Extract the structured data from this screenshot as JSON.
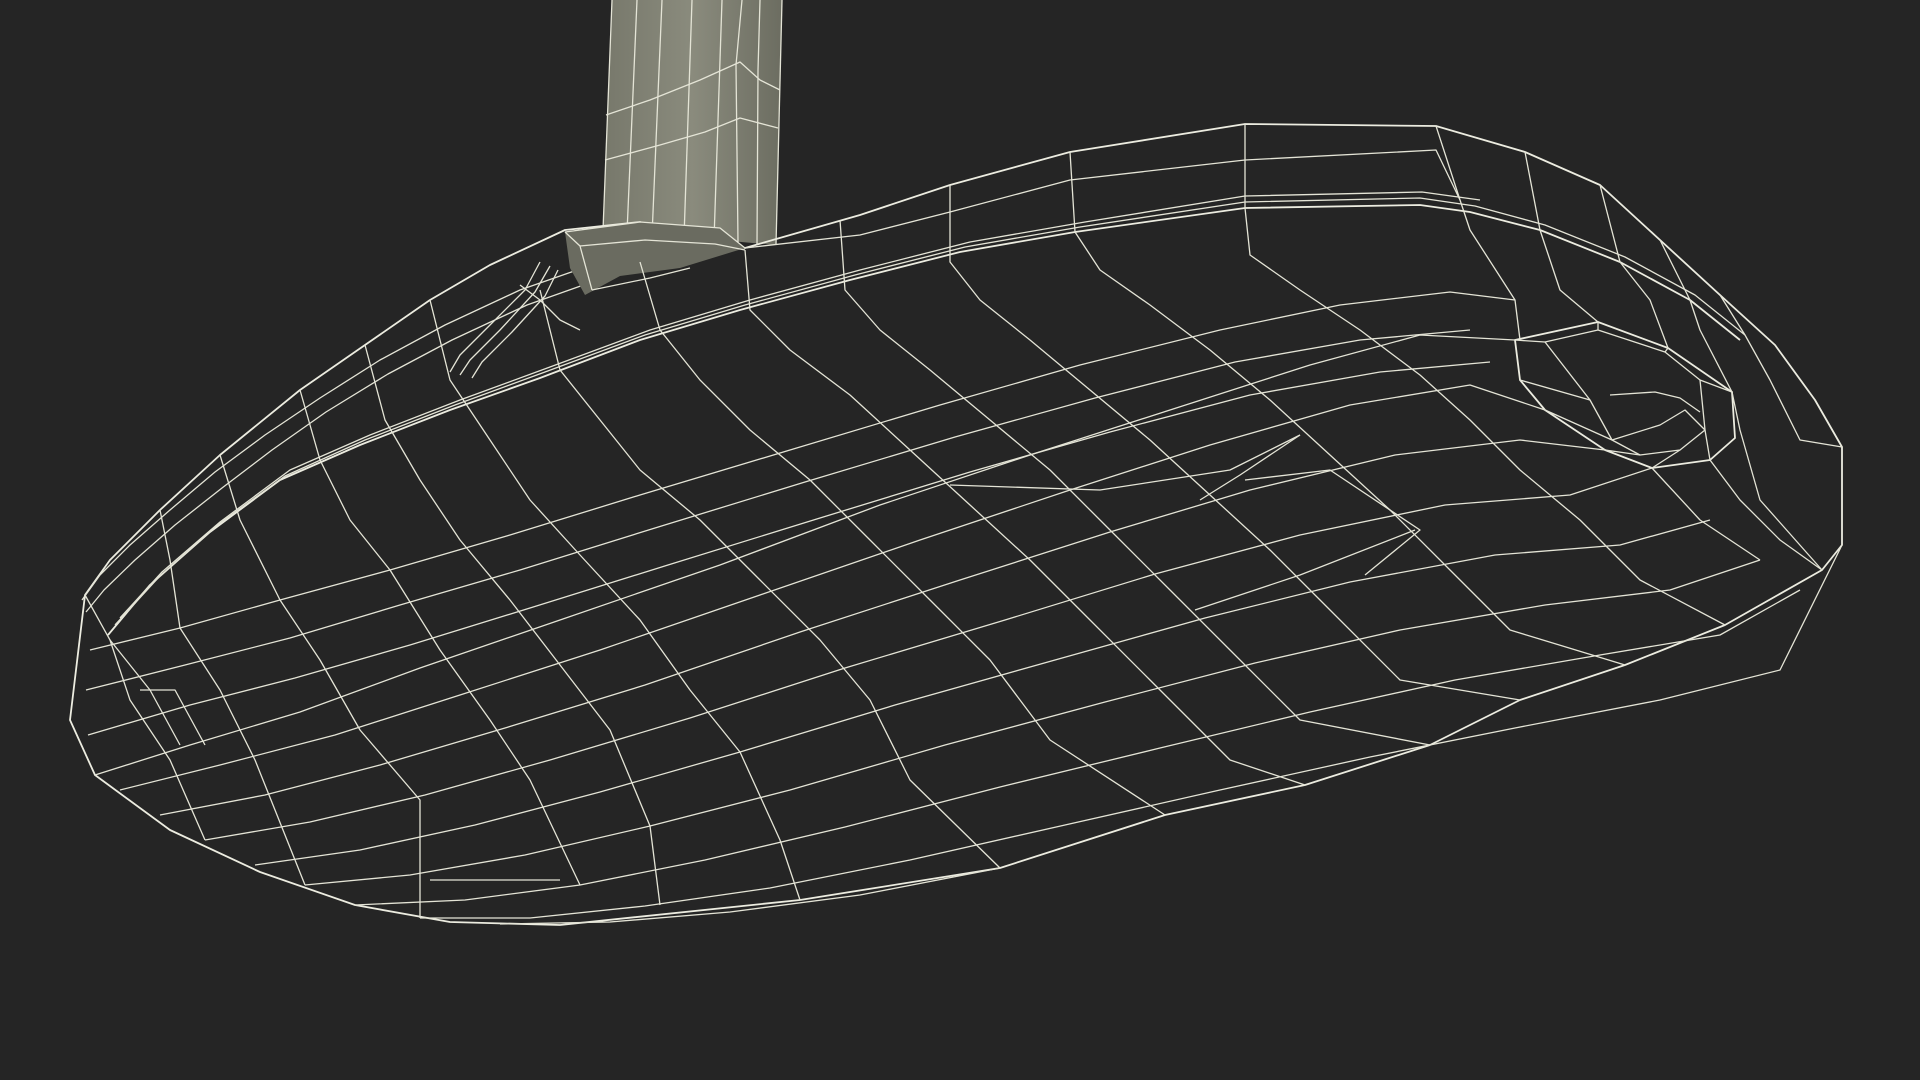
{
  "scene": {
    "subject_icon": "putter-head-wireframe-icon",
    "colors": {
      "background": "#252525",
      "surface": "#7d7e70",
      "surface_dark": "#6f7064",
      "surface_light": "#8a8b7d",
      "wire": "#e4e4d6",
      "hole": "#3a3b36"
    }
  }
}
